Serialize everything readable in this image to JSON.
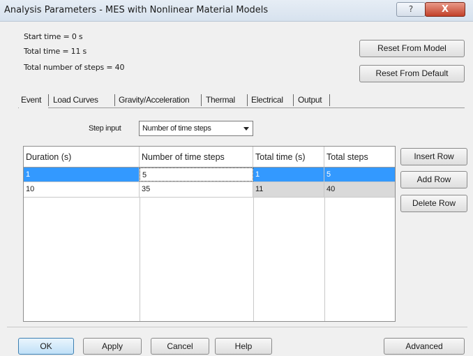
{
  "window": {
    "title": "Analysis Parameters - MES with Nonlinear Material Models",
    "help_glyph": "?",
    "close_glyph": "X"
  },
  "info": {
    "start_time": "Start time = 0 s",
    "total_time": "Total time = 11 s",
    "total_steps": "Total number of steps = 40"
  },
  "reset_buttons": {
    "from_model": "Reset From Model",
    "from_default": "Reset From Default"
  },
  "tabs": [
    {
      "label": "Event",
      "active": true
    },
    {
      "label": "Load Curves",
      "active": false
    },
    {
      "label": "Gravity/Acceleration",
      "active": false
    },
    {
      "label": "Thermal",
      "active": false
    },
    {
      "label": "Electrical",
      "active": false
    },
    {
      "label": "Output",
      "active": false
    }
  ],
  "step_input": {
    "label": "Step input",
    "value": "Number of time steps"
  },
  "table": {
    "columns": [
      "Duration (s)",
      "Number of time steps",
      "Total time (s)",
      "Total steps"
    ],
    "rows": [
      {
        "duration": "1",
        "steps": "5",
        "total_time": "1",
        "total_steps": "5",
        "selected": true
      },
      {
        "duration": "10",
        "steps": "35",
        "total_time": "11",
        "total_steps": "40",
        "selected": false
      }
    ]
  },
  "row_buttons": {
    "insert": "Insert Row",
    "add": "Add Row",
    "delete": "Delete Row"
  },
  "footer": {
    "ok": "OK",
    "apply": "Apply",
    "cancel": "Cancel",
    "help": "Help",
    "advanced": "Advanced"
  },
  "colors": {
    "selection": "#3399ff",
    "computed_cell": "#d9d9d9",
    "dialog_bg": "#f0f0f0"
  }
}
